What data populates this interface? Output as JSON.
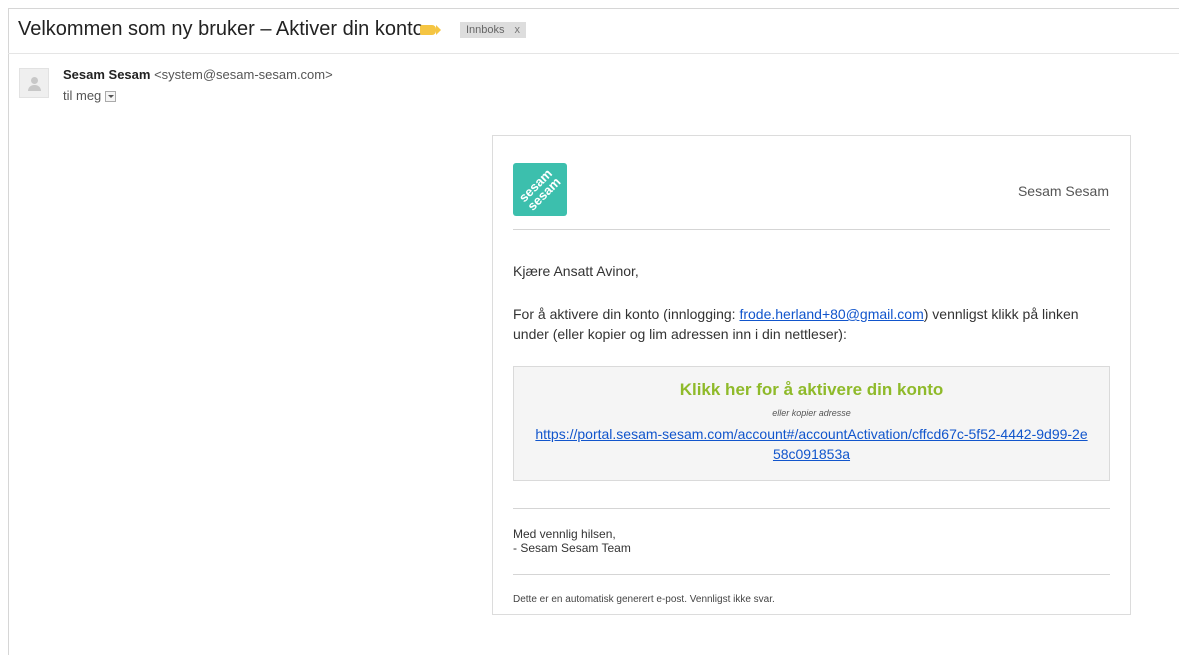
{
  "message": {
    "subject": "Velkommen som ny bruker – Aktiver din konto",
    "label_chip": "Innboks",
    "label_chip_close": "x",
    "label_color": "#f5c542"
  },
  "sender": {
    "name": "Sesam Sesam",
    "email": "<system@sesam-sesam.com>",
    "to_line": "til meg"
  },
  "email_body": {
    "logo_text_line1": "sesam",
    "logo_text_line2": "sesam",
    "logo_color": "#3cbfad",
    "brand_name": "Sesam Sesam",
    "greeting": "Kjære Ansatt Avinor,",
    "para_prefix": "For å aktivere din konto (innlogging: ",
    "login_email": "frode.herland+80@gmail.com",
    "para_suffix": ") vennligst klikk på linken under (eller kopier og lim adressen inn i din nettleser):",
    "cta_title": "Klikk her for å aktivere din konto",
    "cta_title_color": "#8fba2a",
    "cta_or": "eller kopier adresse",
    "activation_url": "https://portal.sesam-sesam.com/account#/accountActivation/cffcd67c-5f52-4442-9d99-2e58c091853a",
    "signoff_line1": "Med vennlig hilsen,",
    "signoff_line2": "- Sesam Sesam Team",
    "footer_note": "Dette er en automatisk generert e-post. Vennligst ikke svar."
  }
}
